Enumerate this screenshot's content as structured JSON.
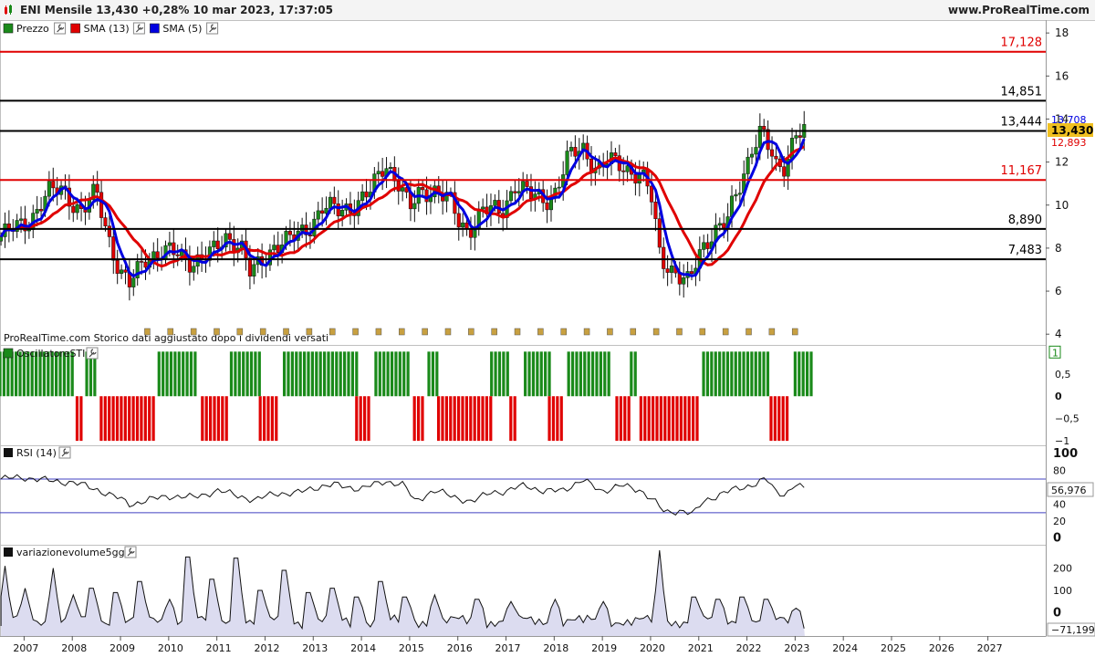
{
  "header": {
    "title": "ENI Mensile 13,430 +0,28% 10 mar 2023, 17:37:05",
    "site": "www.ProRealTime.com",
    "logo_icon": "candlestick-logo-icon"
  },
  "chart_data": [
    {
      "type": "candlestick",
      "panel": "price",
      "legend": [
        {
          "label": "Prezzo",
          "color": "#1a8a1a",
          "icon": "wrench-icon"
        },
        {
          "label": "SMA (13)",
          "color": "#e00000",
          "icon": "wrench-icon"
        },
        {
          "label": "SMA (5)",
          "color": "#0000e0",
          "icon": "wrench-icon"
        }
      ],
      "footnote": "ProRealTime.com  Storico dati aggiustato dopo i dividendi versati",
      "x_labels": [
        "2007",
        "2008",
        "2009",
        "2010",
        "2011",
        "2012",
        "2013",
        "2014",
        "2015",
        "2016",
        "2017",
        "2018",
        "2019",
        "2020",
        "2021",
        "2022",
        "2023",
        "2024",
        "2025",
        "2026",
        "2027"
      ],
      "x_start": 2006.5,
      "x_end": 2028.2,
      "ylim": [
        3.5,
        18.6
      ],
      "y_ticks": [
        4,
        6,
        8,
        10,
        12,
        14,
        16,
        18
      ],
      "horizontal_lines": [
        {
          "value": 17.128,
          "label": "17,128",
          "color": "#e00000"
        },
        {
          "value": 14.851,
          "label": "14,851",
          "color": "#000000"
        },
        {
          "value": 13.444,
          "label": "13,444",
          "color": "#000000"
        },
        {
          "value": 11.167,
          "label": "11,167",
          "color": "#e00000"
        },
        {
          "value": 8.89,
          "label": "8,890",
          "color": "#000000"
        },
        {
          "value": 7.483,
          "label": "7,483",
          "color": "#000000"
        }
      ],
      "last_values": [
        {
          "value": 13.708,
          "label": "13,708",
          "color": "#0000e0"
        },
        {
          "value": 13.43,
          "label": "13,430",
          "color": "#000000",
          "bg": "#f0c020"
        },
        {
          "value": 12.893,
          "label": "12,893",
          "color": "#e00000"
        }
      ],
      "close_anchors": [
        [
          2006.5,
          8.5
        ],
        [
          2007.1,
          9.3
        ],
        [
          2007.5,
          10.5
        ],
        [
          2007.8,
          10.8
        ],
        [
          2008.2,
          9.6
        ],
        [
          2008.5,
          10.6
        ],
        [
          2008.8,
          8.2
        ],
        [
          2009.0,
          6.8
        ],
        [
          2009.2,
          6.2
        ],
        [
          2009.5,
          7.6
        ],
        [
          2009.8,
          7.8
        ],
        [
          2010.2,
          7.7
        ],
        [
          2010.5,
          7.4
        ],
        [
          2010.9,
          7.7
        ],
        [
          2011.2,
          8.6
        ],
        [
          2011.5,
          8.1
        ],
        [
          2011.7,
          6.7
        ],
        [
          2011.9,
          7.3
        ],
        [
          2012.2,
          8.2
        ],
        [
          2012.5,
          8.3
        ],
        [
          2012.9,
          9.0
        ],
        [
          2013.2,
          9.9
        ],
        [
          2013.5,
          9.7
        ],
        [
          2013.9,
          10.1
        ],
        [
          2014.2,
          10.6
        ],
        [
          2014.5,
          12.0
        ],
        [
          2014.8,
          11.0
        ],
        [
          2015.0,
          9.7
        ],
        [
          2015.2,
          10.5
        ],
        [
          2015.5,
          10.8
        ],
        [
          2015.8,
          10.3
        ],
        [
          2016.0,
          9.2
        ],
        [
          2016.2,
          8.8
        ],
        [
          2016.5,
          9.8
        ],
        [
          2016.9,
          9.6
        ],
        [
          2017.2,
          11.1
        ],
        [
          2017.5,
          10.4
        ],
        [
          2017.8,
          10.2
        ],
        [
          2018.0,
          10.6
        ],
        [
          2018.3,
          12.2
        ],
        [
          2018.6,
          12.6
        ],
        [
          2018.9,
          11.7
        ],
        [
          2019.1,
          12.0
        ],
        [
          2019.5,
          11.7
        ],
        [
          2019.8,
          11.5
        ],
        [
          2020.0,
          10.5
        ],
        [
          2020.2,
          7.5
        ],
        [
          2020.5,
          7.0
        ],
        [
          2020.8,
          6.3
        ],
        [
          2021.0,
          7.6
        ],
        [
          2021.3,
          8.9
        ],
        [
          2021.6,
          9.3
        ],
        [
          2021.9,
          11.1
        ],
        [
          2022.1,
          12.8
        ],
        [
          2022.3,
          13.6
        ],
        [
          2022.6,
          11.6
        ],
        [
          2022.8,
          11.8
        ],
        [
          2023.0,
          13.6
        ],
        [
          2023.2,
          13.43
        ]
      ],
      "price_end_year": 2023.2,
      "sma_window_long": 13,
      "sma_window_short": 5
    },
    {
      "type": "bar",
      "panel": "oscillator",
      "legend": {
        "label": "OscillatoreSTI",
        "icon": "wrench-icon"
      },
      "ylim": [
        -1.1,
        1.15
      ],
      "y_ticks": [
        {
          "v": 1,
          "label": "1",
          "boxed": true
        },
        {
          "v": 0.5,
          "label": "0,5"
        },
        {
          "v": 0,
          "label": "0",
          "bold": true
        },
        {
          "v": -0.5,
          "label": "−0,5"
        },
        {
          "v": -1,
          "label": "−1"
        }
      ],
      "colors": {
        "positive": "#1a8a1a",
        "negative": "#e00000"
      },
      "positive_ranges": [
        [
          2006.5,
          2008.0
        ],
        [
          2008.3,
          2008.5
        ],
        [
          2009.8,
          2010.6
        ],
        [
          2011.3,
          2011.9
        ],
        [
          2012.4,
          2013.9
        ],
        [
          2014.3,
          2015.0
        ],
        [
          2015.4,
          2015.6
        ],
        [
          2016.7,
          2017.1
        ],
        [
          2017.4,
          2017.9
        ],
        [
          2018.3,
          2019.2
        ],
        [
          2019.6,
          2019.7
        ],
        [
          2021.1,
          2022.5
        ],
        [
          2023.0,
          2023.4
        ]
      ],
      "negative_ranges": [
        [
          2008.1,
          2008.2
        ],
        [
          2008.6,
          2009.7
        ],
        [
          2010.7,
          2011.2
        ],
        [
          2011.9,
          2012.3
        ],
        [
          2013.9,
          2014.2
        ],
        [
          2015.1,
          2015.3
        ],
        [
          2015.6,
          2016.7
        ],
        [
          2017.1,
          2017.2
        ],
        [
          2017.9,
          2018.2
        ],
        [
          2019.3,
          2019.6
        ],
        [
          2019.8,
          2021.0
        ],
        [
          2022.5,
          2022.9
        ]
      ]
    },
    {
      "type": "line",
      "panel": "rsi",
      "legend": {
        "label": "RSI (14)",
        "icon": "wrench-icon"
      },
      "ylim": [
        -8,
        110
      ],
      "y_ticks": [
        {
          "v": 100,
          "label": "100",
          "bold": true
        },
        {
          "v": 80,
          "label": "80"
        },
        {
          "v": 40,
          "label": "40"
        },
        {
          "v": 20,
          "label": "20"
        },
        {
          "v": 0,
          "label": "0",
          "bold": true
        }
      ],
      "levels": [
        70,
        30
      ],
      "last_value": {
        "value": 56.976,
        "label": "56,976"
      },
      "anchors": [
        [
          2006.5,
          70
        ],
        [
          2007.0,
          72
        ],
        [
          2007.5,
          68
        ],
        [
          2008.0,
          66
        ],
        [
          2008.5,
          58
        ],
        [
          2009.0,
          46
        ],
        [
          2009.2,
          40
        ],
        [
          2009.5,
          44
        ],
        [
          2010.0,
          50
        ],
        [
          2010.5,
          48
        ],
        [
          2011.0,
          56
        ],
        [
          2011.5,
          50
        ],
        [
          2011.8,
          44
        ],
        [
          2012.2,
          54
        ],
        [
          2012.6,
          52
        ],
        [
          2013.0,
          60
        ],
        [
          2013.5,
          63
        ],
        [
          2014.0,
          58
        ],
        [
          2014.5,
          68
        ],
        [
          2014.9,
          62
        ],
        [
          2015.1,
          44
        ],
        [
          2015.5,
          56
        ],
        [
          2016.0,
          48
        ],
        [
          2016.3,
          42
        ],
        [
          2016.7,
          56
        ],
        [
          2017.0,
          54
        ],
        [
          2017.4,
          64
        ],
        [
          2017.8,
          54
        ],
        [
          2018.2,
          58
        ],
        [
          2018.6,
          68
        ],
        [
          2019.0,
          56
        ],
        [
          2019.4,
          62
        ],
        [
          2019.8,
          57
        ],
        [
          2020.1,
          42
        ],
        [
          2020.3,
          30
        ],
        [
          2020.6,
          33
        ],
        [
          2020.9,
          28
        ],
        [
          2021.1,
          44
        ],
        [
          2021.5,
          53
        ],
        [
          2021.9,
          60
        ],
        [
          2022.2,
          65
        ],
        [
          2022.4,
          70
        ],
        [
          2022.6,
          55
        ],
        [
          2022.8,
          52
        ],
        [
          2023.0,
          64
        ],
        [
          2023.2,
          57
        ]
      ]
    },
    {
      "type": "area",
      "panel": "volume",
      "legend": {
        "label": "variazionevolume5gg",
        "icon": "wrench-icon"
      },
      "ylim": [
        -105,
        305
      ],
      "y_ticks": [
        {
          "v": 200,
          "label": "200"
        },
        {
          "v": 100,
          "label": "100"
        },
        {
          "v": 0,
          "label": "0",
          "bold": true
        }
      ],
      "last_value": {
        "value": -71.199,
        "label": "−71,199"
      },
      "fill": "#dcdcf0",
      "spikes": [
        [
          2006.6,
          210
        ],
        [
          2007.0,
          110
        ],
        [
          2007.6,
          200
        ],
        [
          2008.0,
          80
        ],
        [
          2008.4,
          110
        ],
        [
          2008.9,
          90
        ],
        [
          2009.4,
          140
        ],
        [
          2010.0,
          60
        ],
        [
          2010.4,
          250
        ],
        [
          2010.9,
          150
        ],
        [
          2011.4,
          245
        ],
        [
          2011.9,
          100
        ],
        [
          2012.4,
          190
        ],
        [
          2012.9,
          90
        ],
        [
          2013.4,
          110
        ],
        [
          2013.9,
          70
        ],
        [
          2014.4,
          140
        ],
        [
          2014.9,
          70
        ],
        [
          2015.5,
          80
        ],
        [
          2016.4,
          60
        ],
        [
          2017.1,
          50
        ],
        [
          2018.0,
          60
        ],
        [
          2019.0,
          50
        ],
        [
          2020.2,
          280
        ],
        [
          2020.9,
          70
        ],
        [
          2021.4,
          60
        ],
        [
          2021.9,
          70
        ],
        [
          2022.4,
          60
        ],
        [
          2023.0,
          20
        ],
        [
          2023.2,
          -71
        ]
      ]
    }
  ]
}
